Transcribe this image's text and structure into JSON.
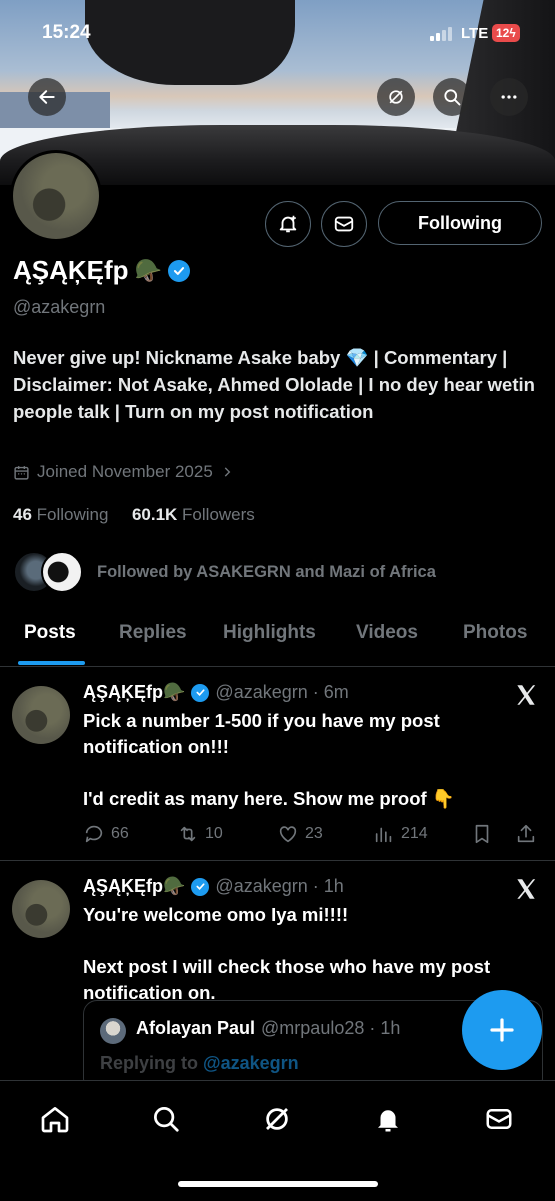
{
  "status_bar": {
    "time": "15:24",
    "network": "LTE",
    "battery": "12"
  },
  "profile": {
    "display_name": "ĄŞĄĶĘfp",
    "name_emoji": "🪖",
    "handle": "@azakegrn",
    "bio": "Never give up! Nickname Asake baby 💎 | Commentary | Disclaimer: Not Asake, Ahmed Ololade | I no dey hear wetin people talk | Turn on my post notification",
    "joined": "Joined November 2025",
    "following_count": "46",
    "following_label": "Following",
    "followers_count": "60.1K",
    "followers_label": "Followers",
    "followed_by": "Followed by ASAKEGRN and Mazi of Africa",
    "follow_button": "Following"
  },
  "tabs": [
    "Posts",
    "Replies",
    "Highlights",
    "Videos",
    "Photos"
  ],
  "posts": [
    {
      "name": "ĄŞĄĶĘfp🪖",
      "handle": "@azakegrn · 6m",
      "text": "Pick a number 1-500 if you have my post notification on!!!\n\nI'd credit as many here. Show me proof 👇",
      "replies": "66",
      "reposts": "10",
      "likes": "23",
      "views": "214"
    },
    {
      "name": "ĄŞĄĶĘfp🪖",
      "handle": "@azakegrn · 1h",
      "text": "You're welcome omo Iya mi!!!!\n\nNext post I will check those who have my post notification on.",
      "quote": {
        "name": "Afolayan Paul",
        "handle": "@mrpaulo28 · 1h",
        "reply_prefix": "Replying to",
        "reply_to": "@azakegrn"
      }
    }
  ],
  "colors": {
    "accent": "#1d9bf0",
    "background": "#000000",
    "muted": "#71767b"
  }
}
